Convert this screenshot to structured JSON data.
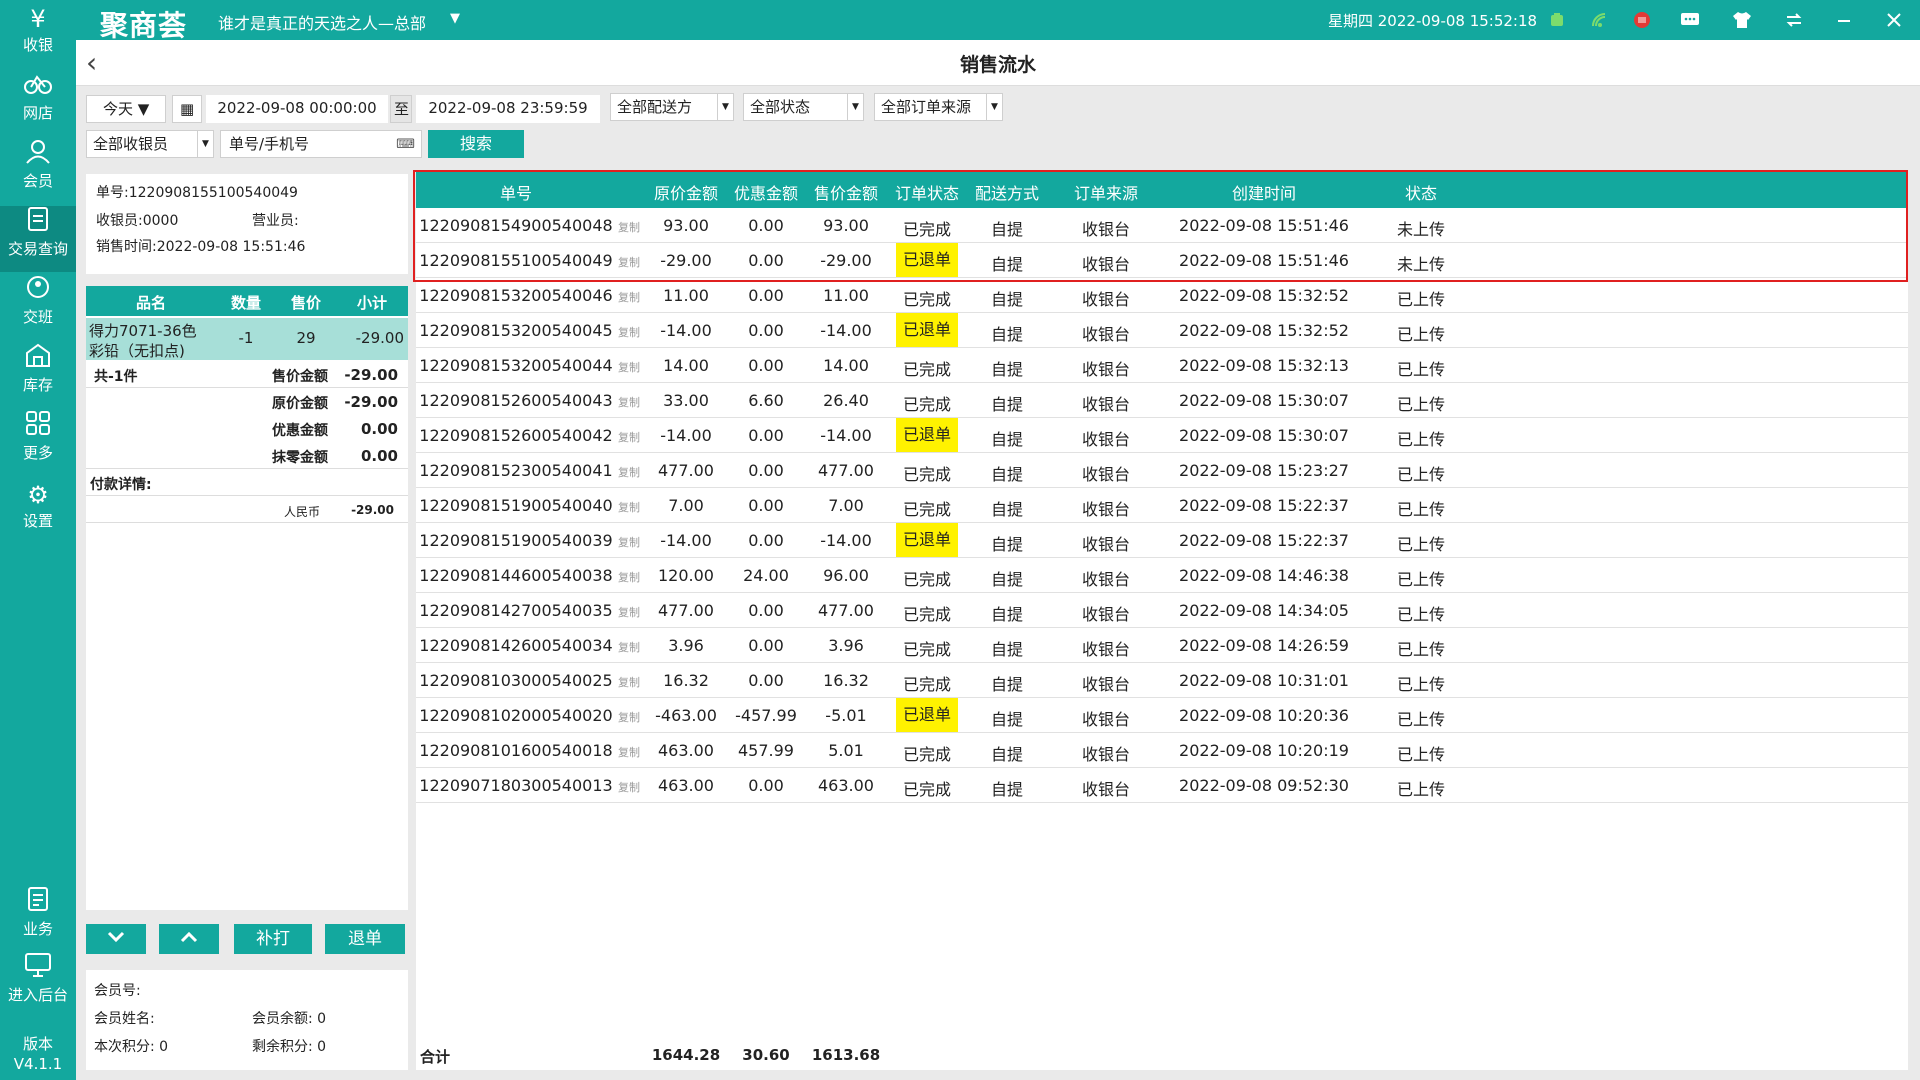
{
  "app": {
    "brand": "聚商荟",
    "store_name": "谁才是真正的天选之人—总部",
    "datetime": "星期四 2022-09-08 15:52:18",
    "page_title": "销售流水",
    "version_label": "版本",
    "version": "V4.1.1"
  },
  "colors": {
    "accent": "#13a89e",
    "refund_highlight": "#fff200",
    "selection_box": "#e02020"
  },
  "titlebar_icons": [
    "battery-icon",
    "wifi-icon",
    "record-icon",
    "message-icon",
    "shirt-icon",
    "swap-icon",
    "minimize-icon",
    "close-icon"
  ],
  "sidebar": {
    "items": [
      {
        "label": "收银",
        "icon": "cashier-icon"
      },
      {
        "label": "网店",
        "icon": "bike-icon"
      },
      {
        "label": "会员",
        "icon": "member-icon"
      },
      {
        "label": "交易查询",
        "icon": "document-icon",
        "active": true
      },
      {
        "label": "交班",
        "icon": "shift-icon"
      },
      {
        "label": "库存",
        "icon": "warehouse-icon"
      },
      {
        "label": "更多",
        "icon": "grid-icon"
      },
      {
        "label": "设置",
        "icon": "gear-icon"
      },
      {
        "label": "业务",
        "icon": "business-icon"
      },
      {
        "label": "进入后台",
        "icon": "monitor-icon"
      }
    ]
  },
  "filters": {
    "date_preset": "今天",
    "start": "2022-09-08 00:00:00",
    "to_label": "至",
    "end": "2022-09-08 23:59:59",
    "delivery": "全部配送方",
    "status": "全部状态",
    "source": "全部订单来源",
    "cashier": "全部收银员",
    "search_placeholder": "单号/手机号",
    "search_button": "搜索"
  },
  "order_detail": {
    "order_no": "单号:1220908155100540049",
    "cashier": "收银员:0000",
    "salesperson": "营业员:",
    "sale_time": "销售时间:2022-09-08 15:51:46",
    "columns": [
      "品名",
      "数量",
      "售价",
      "小计"
    ],
    "item": {
      "name_line1": "得力7071-36色",
      "name_line2": "彩铅（无扣点)",
      "qty": "-1",
      "price": "29",
      "subtotal": "-29.00"
    },
    "count": "共-1件",
    "sale_amount_label": "售价金额",
    "sale_amount": "-29.00",
    "orig_amount_label": "原价金额",
    "orig_amount": "-29.00",
    "discount_label": "优惠金额",
    "discount": "0.00",
    "rounding_label": "抹零金额",
    "rounding": "0.00",
    "payment_title": "付款详情:",
    "payment_method": "人民币",
    "payment_amount": "-29.00"
  },
  "actions": {
    "reprint": "补打",
    "refund": "退单"
  },
  "member": {
    "member_no": "会员号:",
    "member_name": "会员姓名:",
    "balance": "会员余额:  0",
    "points_this": "本次积分:  0",
    "points_left": "剩余积分:  0"
  },
  "table": {
    "columns": [
      "单号",
      "原价金额",
      "优惠金额",
      "售价金额",
      "订单状态",
      "配送方式",
      "订单来源",
      "创建时间",
      "状态"
    ],
    "copy_label": "复制",
    "rows": [
      {
        "no": "1220908154900540048",
        "orig": "93.00",
        "disc": "0.00",
        "sale": "93.00",
        "ostatus": "已完成",
        "refund": false,
        "delivery": "自提",
        "source": "收银台",
        "time": "2022-09-08 15:51:46",
        "upload": "未上传"
      },
      {
        "no": "1220908155100540049",
        "orig": "-29.00",
        "disc": "0.00",
        "sale": "-29.00",
        "ostatus": "已退单",
        "refund": true,
        "delivery": "自提",
        "source": "收银台",
        "time": "2022-09-08 15:51:46",
        "upload": "未上传"
      },
      {
        "no": "1220908153200540046",
        "orig": "11.00",
        "disc": "0.00",
        "sale": "11.00",
        "ostatus": "已完成",
        "refund": false,
        "delivery": "自提",
        "source": "收银台",
        "time": "2022-09-08 15:32:52",
        "upload": "已上传"
      },
      {
        "no": "1220908153200540045",
        "orig": "-14.00",
        "disc": "0.00",
        "sale": "-14.00",
        "ostatus": "已退单",
        "refund": true,
        "delivery": "自提",
        "source": "收银台",
        "time": "2022-09-08 15:32:52",
        "upload": "已上传"
      },
      {
        "no": "1220908153200540044",
        "orig": "14.00",
        "disc": "0.00",
        "sale": "14.00",
        "ostatus": "已完成",
        "refund": false,
        "delivery": "自提",
        "source": "收银台",
        "time": "2022-09-08 15:32:13",
        "upload": "已上传"
      },
      {
        "no": "1220908152600540043",
        "orig": "33.00",
        "disc": "6.60",
        "sale": "26.40",
        "ostatus": "已完成",
        "refund": false,
        "delivery": "自提",
        "source": "收银台",
        "time": "2022-09-08 15:30:07",
        "upload": "已上传"
      },
      {
        "no": "1220908152600540042",
        "orig": "-14.00",
        "disc": "0.00",
        "sale": "-14.00",
        "ostatus": "已退单",
        "refund": true,
        "delivery": "自提",
        "source": "收银台",
        "time": "2022-09-08 15:30:07",
        "upload": "已上传"
      },
      {
        "no": "1220908152300540041",
        "orig": "477.00",
        "disc": "0.00",
        "sale": "477.00",
        "ostatus": "已完成",
        "refund": false,
        "delivery": "自提",
        "source": "收银台",
        "time": "2022-09-08 15:23:27",
        "upload": "已上传"
      },
      {
        "no": "1220908151900540040",
        "orig": "7.00",
        "disc": "0.00",
        "sale": "7.00",
        "ostatus": "已完成",
        "refund": false,
        "delivery": "自提",
        "source": "收银台",
        "time": "2022-09-08 15:22:37",
        "upload": "已上传"
      },
      {
        "no": "1220908151900540039",
        "orig": "-14.00",
        "disc": "0.00",
        "sale": "-14.00",
        "ostatus": "已退单",
        "refund": true,
        "delivery": "自提",
        "source": "收银台",
        "time": "2022-09-08 15:22:37",
        "upload": "已上传"
      },
      {
        "no": "1220908144600540038",
        "orig": "120.00",
        "disc": "24.00",
        "sale": "96.00",
        "ostatus": "已完成",
        "refund": false,
        "delivery": "自提",
        "source": "收银台",
        "time": "2022-09-08 14:46:38",
        "upload": "已上传"
      },
      {
        "no": "1220908142700540035",
        "orig": "477.00",
        "disc": "0.00",
        "sale": "477.00",
        "ostatus": "已完成",
        "refund": false,
        "delivery": "自提",
        "source": "收银台",
        "time": "2022-09-08 14:34:05",
        "upload": "已上传"
      },
      {
        "no": "1220908142600540034",
        "orig": "3.96",
        "disc": "0.00",
        "sale": "3.96",
        "ostatus": "已完成",
        "refund": false,
        "delivery": "自提",
        "source": "收银台",
        "time": "2022-09-08 14:26:59",
        "upload": "已上传"
      },
      {
        "no": "1220908103000540025",
        "orig": "16.32",
        "disc": "0.00",
        "sale": "16.32",
        "ostatus": "已完成",
        "refund": false,
        "delivery": "自提",
        "source": "收银台",
        "time": "2022-09-08 10:31:01",
        "upload": "已上传"
      },
      {
        "no": "1220908102000540020",
        "orig": "-463.00",
        "disc": "-457.99",
        "sale": "-5.01",
        "ostatus": "已退单",
        "refund": true,
        "delivery": "自提",
        "source": "收银台",
        "time": "2022-09-08 10:20:36",
        "upload": "已上传"
      },
      {
        "no": "1220908101600540018",
        "orig": "463.00",
        "disc": "457.99",
        "sale": "5.01",
        "ostatus": "已完成",
        "refund": false,
        "delivery": "自提",
        "source": "收银台",
        "time": "2022-09-08 10:20:19",
        "upload": "已上传"
      },
      {
        "no": "1220907180300540013",
        "orig": "463.00",
        "disc": "0.00",
        "sale": "463.00",
        "ostatus": "已完成",
        "refund": false,
        "delivery": "自提",
        "source": "收银台",
        "time": "2022-09-08 09:52:30",
        "upload": "已上传"
      }
    ],
    "totals": {
      "label": "合计",
      "orig": "1644.28",
      "disc": "30.60",
      "sale": "1613.68"
    }
  }
}
